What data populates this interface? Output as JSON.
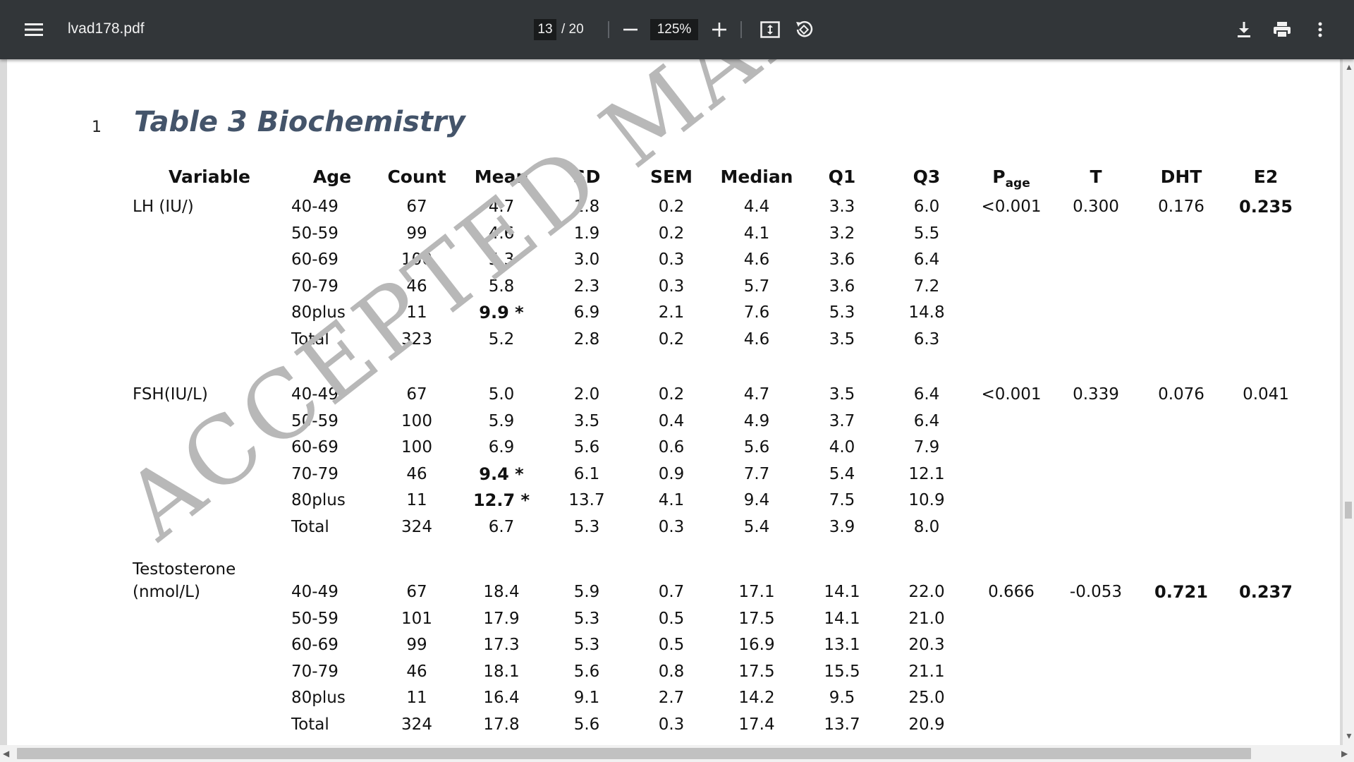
{
  "toolbar": {
    "title": "lvad178.pdf",
    "page_current": "13",
    "page_total": "/ 20",
    "zoom": "125%",
    "icons": [
      "menu-icon",
      "zoom-out-icon",
      "zoom-in-icon",
      "fit-page-icon",
      "rotate-icon",
      "download-icon",
      "print-icon",
      "more-vert-icon"
    ]
  },
  "document": {
    "line_number": "1",
    "table_title": "Table 3 Biochemistry",
    "watermark": "ACCEPTED MANUSCRIPT",
    "headers": {
      "variable": "Variable",
      "age": "Age",
      "count": "Count",
      "mean": "Mean",
      "sd": "SD",
      "sem": "SEM",
      "median": "Median",
      "q1": "Q1",
      "q3": "Q3",
      "p_main": "P",
      "p_sub": "age",
      "t": "T",
      "dht": "DHT",
      "e2": "E2"
    },
    "groups": [
      {
        "label": "LH (IU/)",
        "stats": {
          "p_age": "<0.001",
          "t": "0.300",
          "dht": "0.176",
          "e2": "0.235"
        },
        "bold_stats": [
          "e2"
        ],
        "rows": [
          {
            "age": "40-49",
            "count": "67",
            "mean": "4.7",
            "sd": "1.8",
            "sem": "0.2",
            "median": "4.4",
            "q1": "3.3",
            "q3": "6.0",
            "mean_bold": false
          },
          {
            "age": "50-59",
            "count": "99",
            "mean": "4.6",
            "sd": "1.9",
            "sem": "0.2",
            "median": "4.1",
            "q1": "3.2",
            "q3": "5.5",
            "mean_bold": false
          },
          {
            "age": "60-69",
            "count": "100",
            "mean": "5.3",
            "sd": "3.0",
            "sem": "0.3",
            "median": "4.6",
            "q1": "3.6",
            "q3": "6.4",
            "mean_bold": false
          },
          {
            "age": "70-79",
            "count": "46",
            "mean": "5.8",
            "sd": "2.3",
            "sem": "0.3",
            "median": "5.7",
            "q1": "3.6",
            "q3": "7.2",
            "mean_bold": false
          },
          {
            "age": "80plus",
            "count": "11",
            "mean": "9.9 *",
            "sd": "6.9",
            "sem": "2.1",
            "median": "7.6",
            "q1": "5.3",
            "q3": "14.8",
            "mean_bold": true
          },
          {
            "age": "Total",
            "count": "323",
            "mean": "5.2",
            "sd": "2.8",
            "sem": "0.2",
            "median": "4.6",
            "q1": "3.5",
            "q3": "6.3",
            "mean_bold": false
          }
        ]
      },
      {
        "label": "FSH(IU/L)",
        "stats": {
          "p_age": "<0.001",
          "t": "0.339",
          "dht": "0.076",
          "e2": "0.041"
        },
        "bold_stats": [],
        "rows": [
          {
            "age": "40-49",
            "count": "67",
            "mean": "5.0",
            "sd": "2.0",
            "sem": "0.2",
            "median": "4.7",
            "q1": "3.5",
            "q3": "6.4",
            "mean_bold": false
          },
          {
            "age": "50-59",
            "count": "100",
            "mean": "5.9",
            "sd": "3.5",
            "sem": "0.4",
            "median": "4.9",
            "q1": "3.7",
            "q3": "6.4",
            "mean_bold": false
          },
          {
            "age": "60-69",
            "count": "100",
            "mean": "6.9",
            "sd": "5.6",
            "sem": "0.6",
            "median": "5.6",
            "q1": "4.0",
            "q3": "7.9",
            "mean_bold": false
          },
          {
            "age": "70-79",
            "count": "46",
            "mean": "9.4 *",
            "sd": "6.1",
            "sem": "0.9",
            "median": "7.7",
            "q1": "5.4",
            "q3": "12.1",
            "mean_bold": true
          },
          {
            "age": "80plus",
            "count": "11",
            "mean": "12.7 *",
            "sd": "13.7",
            "sem": "4.1",
            "median": "9.4",
            "q1": "7.5",
            "q3": "10.9",
            "mean_bold": true
          },
          {
            "age": "Total",
            "count": "324",
            "mean": "6.7",
            "sd": "5.3",
            "sem": "0.3",
            "median": "5.4",
            "q1": "3.9",
            "q3": "8.0",
            "mean_bold": false
          }
        ]
      },
      {
        "label": "Testosterone",
        "label2": "(nmol/L)",
        "stats": {
          "p_age": "0.666",
          "t": "-0.053",
          "dht": "0.721",
          "e2": "0.237"
        },
        "bold_stats": [
          "dht",
          "e2"
        ],
        "rows": [
          {
            "age": "40-49",
            "count": "67",
            "mean": "18.4",
            "sd": "5.9",
            "sem": "0.7",
            "median": "17.1",
            "q1": "14.1",
            "q3": "22.0",
            "mean_bold": false
          },
          {
            "age": "50-59",
            "count": "101",
            "mean": "17.9",
            "sd": "5.3",
            "sem": "0.5",
            "median": "17.5",
            "q1": "14.1",
            "q3": "21.0",
            "mean_bold": false
          },
          {
            "age": "60-69",
            "count": "99",
            "mean": "17.3",
            "sd": "5.3",
            "sem": "0.5",
            "median": "16.9",
            "q1": "13.1",
            "q3": "20.3",
            "mean_bold": false
          },
          {
            "age": "70-79",
            "count": "46",
            "mean": "18.1",
            "sd": "5.6",
            "sem": "0.8",
            "median": "17.5",
            "q1": "15.5",
            "q3": "21.1",
            "mean_bold": false
          },
          {
            "age": "80plus",
            "count": "11",
            "mean": "16.4",
            "sd": "9.1",
            "sem": "2.7",
            "median": "14.2",
            "q1": "9.5",
            "q3": "25.0",
            "mean_bold": false
          },
          {
            "age": "Total",
            "count": "324",
            "mean": "17.8",
            "sd": "5.6",
            "sem": "0.3",
            "median": "17.4",
            "q1": "13.7",
            "q3": "20.9",
            "mean_bold": false
          }
        ]
      }
    ]
  }
}
